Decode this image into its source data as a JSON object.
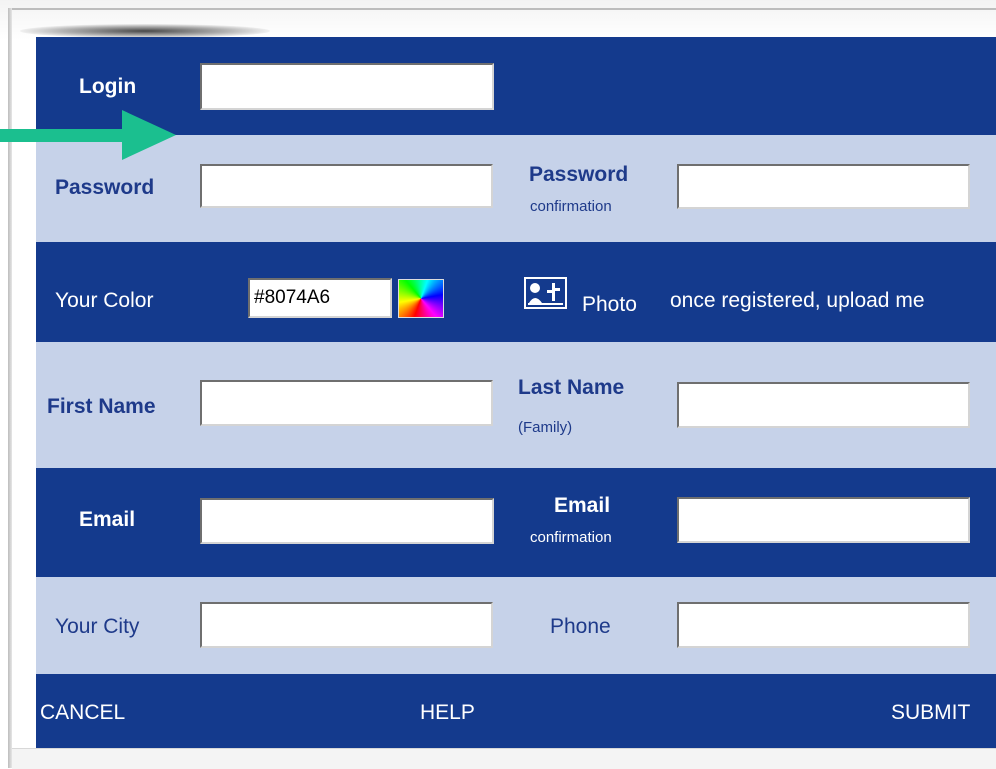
{
  "form": {
    "login_label": "Login",
    "login_value": "",
    "password_label": "Password",
    "password_value": "",
    "password_confirmation_label": "Password",
    "password_confirmation_sub": "confirmation",
    "password_confirmation_value": "",
    "color_label": "Your Color",
    "color_value": "#8074A6",
    "photo_label": "Photo",
    "photo_note": "once registered, upload me",
    "first_name_label": "First Name",
    "first_name_value": "",
    "last_name_label": "Last Name",
    "last_name_sub": "(Family)",
    "last_name_value": "",
    "email_label": "Email",
    "email_value": "",
    "email_confirmation_label": "Email",
    "email_confirmation_sub": "confirmation",
    "email_confirmation_value": "",
    "city_label": "Your City",
    "city_value": "",
    "phone_label": "Phone",
    "phone_value": ""
  },
  "footer": {
    "cancel": "CANCEL",
    "help": "HELP",
    "submit": "SUBMIT"
  },
  "icons": {
    "color_picker": "color-wheel-icon",
    "photo": "photo-icon",
    "pointer": "arrow-right-icon"
  },
  "colors": {
    "dark_band": "#143a8d",
    "light_band": "#c6d2e9",
    "dark_text": "#1e3a8a",
    "arrow": "#1bbf8f"
  }
}
